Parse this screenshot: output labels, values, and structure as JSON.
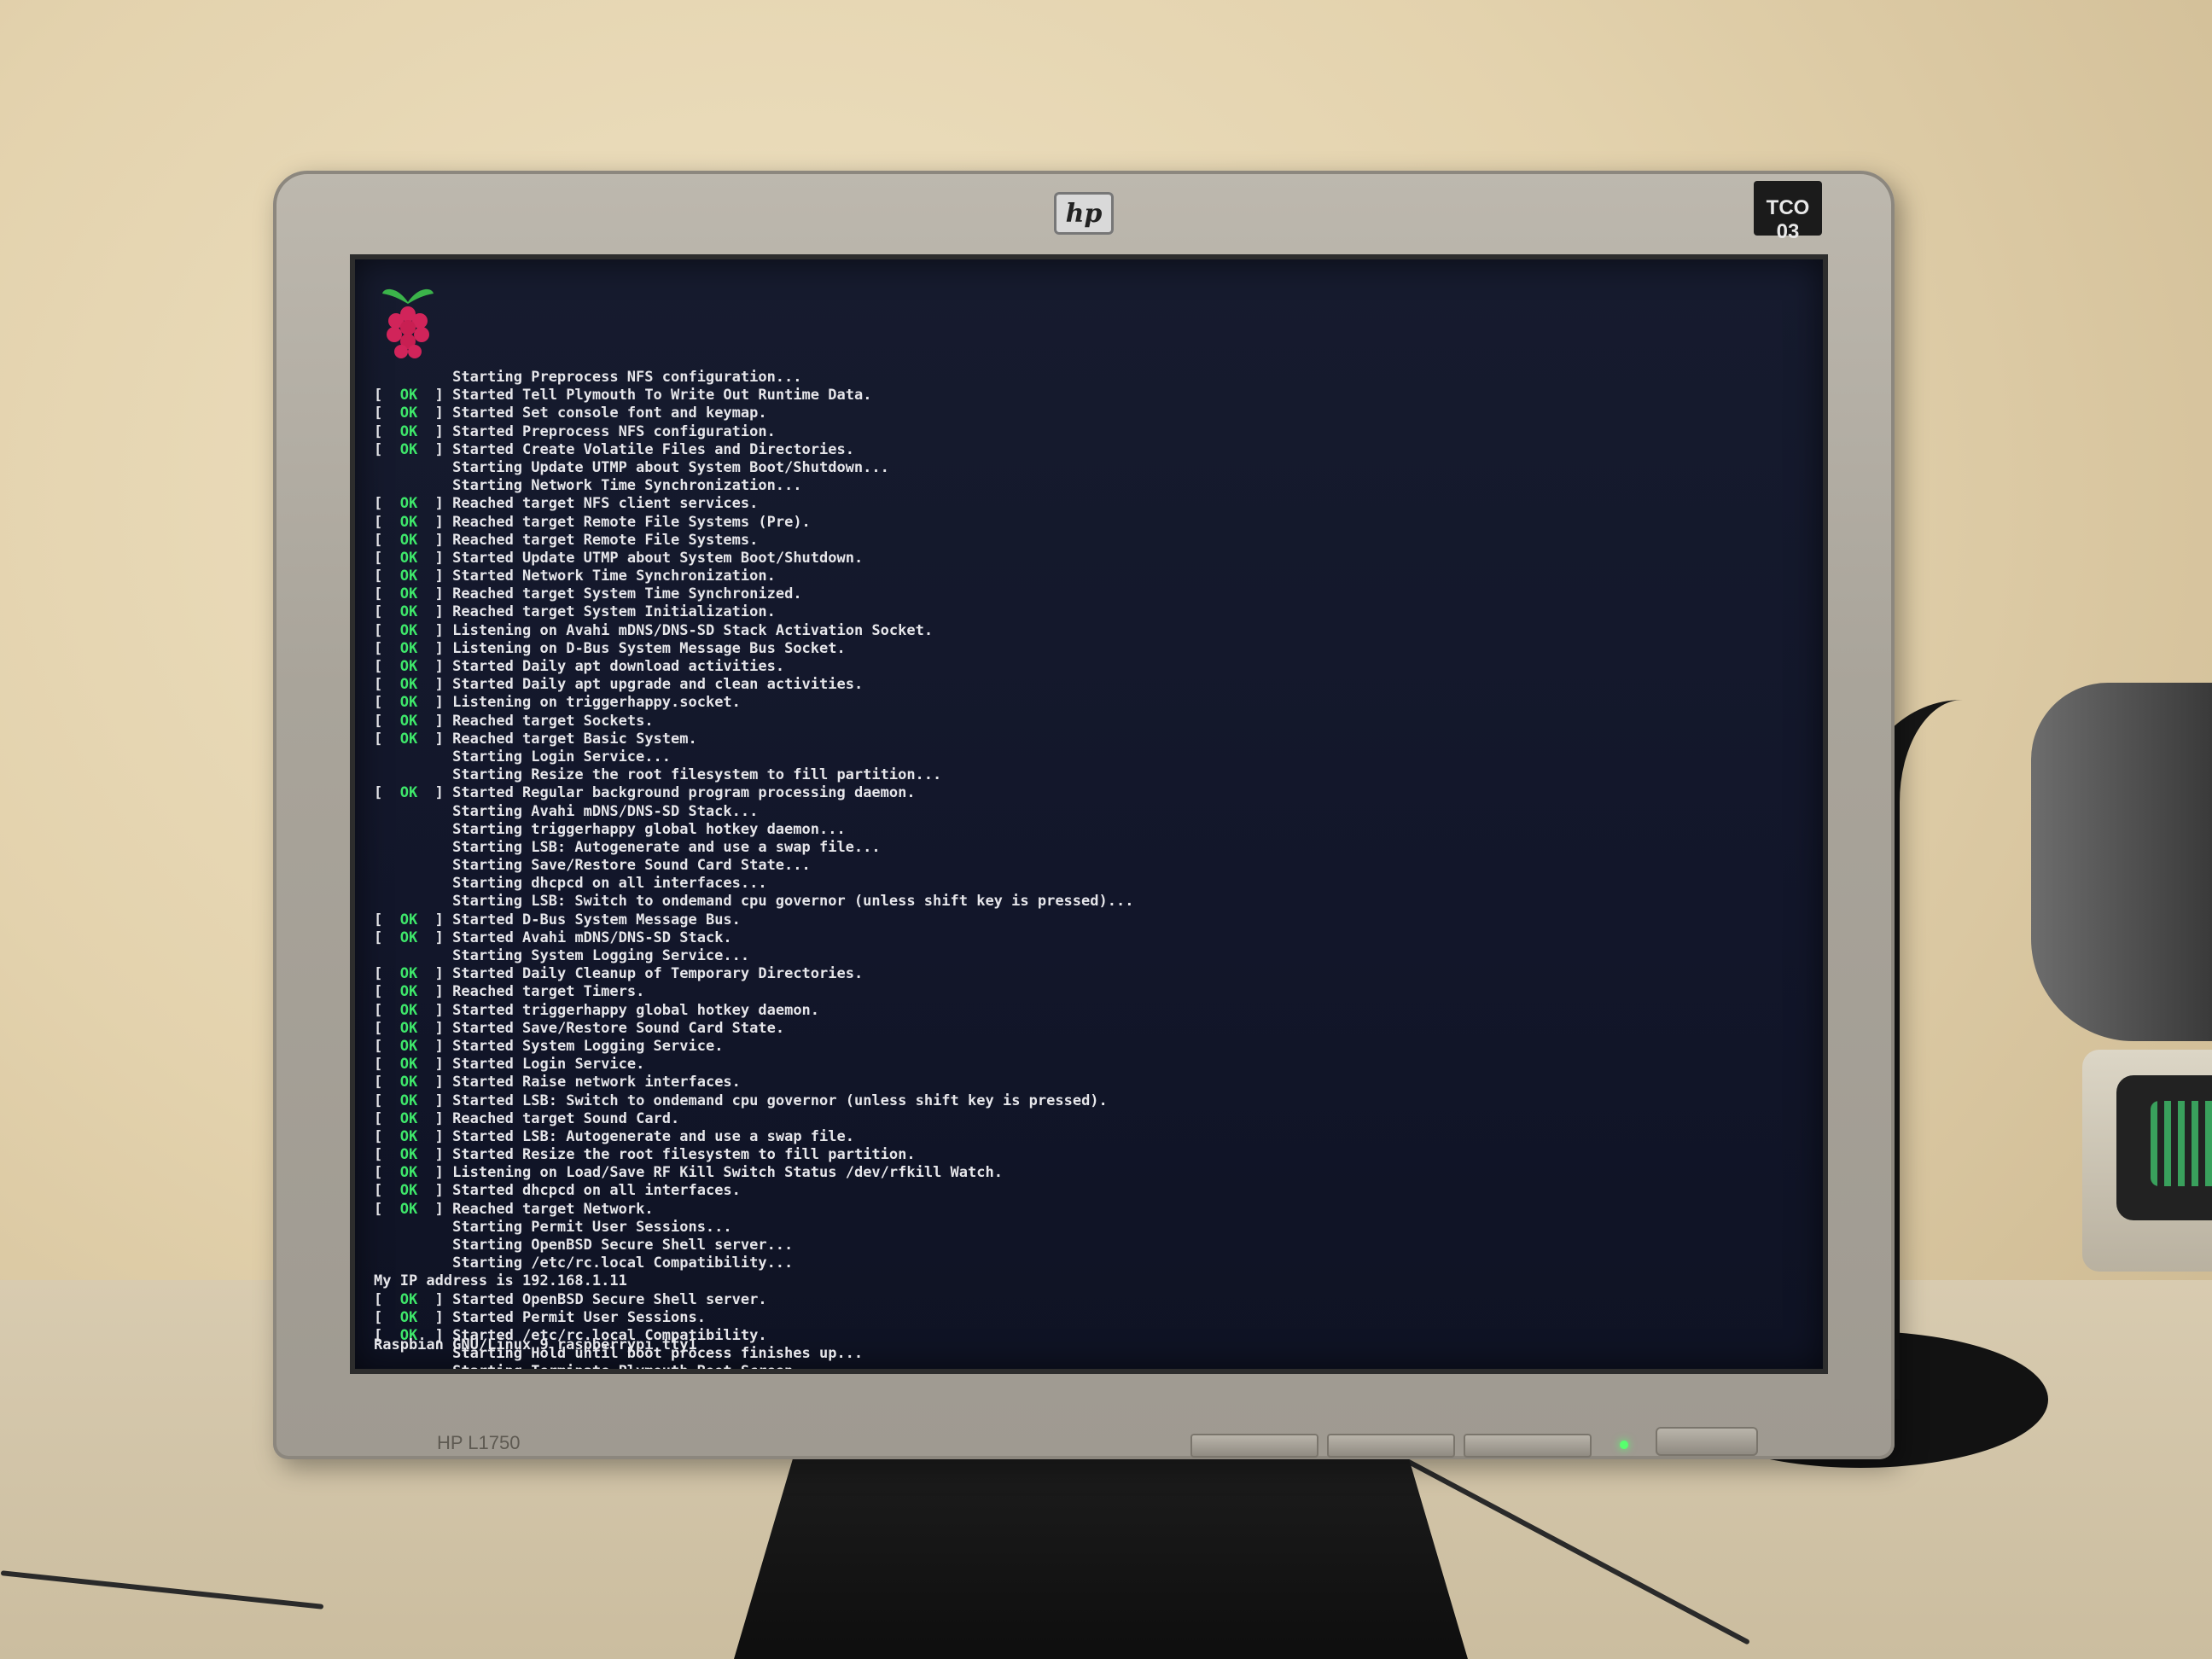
{
  "monitor": {
    "brand_logo": "hp",
    "badge": "TCO 03",
    "model": "HP L1750"
  },
  "screen": {
    "logo": "raspberry-pi-icon",
    "boot_log": [
      {
        "status": "",
        "text": "         Starting Preprocess NFS configuration..."
      },
      {
        "status": "OK",
        "text": "Started Tell Plymouth To Write Out Runtime Data."
      },
      {
        "status": "OK",
        "text": "Started Set console font and keymap."
      },
      {
        "status": "OK",
        "text": "Started Preprocess NFS configuration."
      },
      {
        "status": "OK",
        "text": "Started Create Volatile Files and Directories."
      },
      {
        "status": "",
        "text": "         Starting Update UTMP about System Boot/Shutdown..."
      },
      {
        "status": "",
        "text": "         Starting Network Time Synchronization..."
      },
      {
        "status": "OK",
        "text": "Reached target NFS client services."
      },
      {
        "status": "OK",
        "text": "Reached target Remote File Systems (Pre)."
      },
      {
        "status": "OK",
        "text": "Reached target Remote File Systems."
      },
      {
        "status": "OK",
        "text": "Started Update UTMP about System Boot/Shutdown."
      },
      {
        "status": "OK",
        "text": "Started Network Time Synchronization."
      },
      {
        "status": "OK",
        "text": "Reached target System Time Synchronized."
      },
      {
        "status": "OK",
        "text": "Reached target System Initialization."
      },
      {
        "status": "OK",
        "text": "Listening on Avahi mDNS/DNS-SD Stack Activation Socket."
      },
      {
        "status": "OK",
        "text": "Listening on D-Bus System Message Bus Socket."
      },
      {
        "status": "OK",
        "text": "Started Daily apt download activities."
      },
      {
        "status": "OK",
        "text": "Started Daily apt upgrade and clean activities."
      },
      {
        "status": "OK",
        "text": "Listening on triggerhappy.socket."
      },
      {
        "status": "OK",
        "text": "Reached target Sockets."
      },
      {
        "status": "OK",
        "text": "Reached target Basic System."
      },
      {
        "status": "",
        "text": "         Starting Login Service..."
      },
      {
        "status": "",
        "text": "         Starting Resize the root filesystem to fill partition..."
      },
      {
        "status": "OK",
        "text": "Started Regular background program processing daemon."
      },
      {
        "status": "",
        "text": "         Starting Avahi mDNS/DNS-SD Stack..."
      },
      {
        "status": "",
        "text": "         Starting triggerhappy global hotkey daemon..."
      },
      {
        "status": "",
        "text": "         Starting LSB: Autogenerate and use a swap file..."
      },
      {
        "status": "",
        "text": "         Starting Save/Restore Sound Card State..."
      },
      {
        "status": "",
        "text": "         Starting dhcpcd on all interfaces..."
      },
      {
        "status": "",
        "text": "         Starting LSB: Switch to ondemand cpu governor (unless shift key is pressed)..."
      },
      {
        "status": "OK",
        "text": "Started D-Bus System Message Bus."
      },
      {
        "status": "OK",
        "text": "Started Avahi mDNS/DNS-SD Stack."
      },
      {
        "status": "",
        "text": "         Starting System Logging Service..."
      },
      {
        "status": "OK",
        "text": "Started Daily Cleanup of Temporary Directories."
      },
      {
        "status": "OK",
        "text": "Reached target Timers."
      },
      {
        "status": "OK",
        "text": "Started triggerhappy global hotkey daemon."
      },
      {
        "status": "OK",
        "text": "Started Save/Restore Sound Card State."
      },
      {
        "status": "OK",
        "text": "Started System Logging Service."
      },
      {
        "status": "OK",
        "text": "Started Login Service."
      },
      {
        "status": "OK",
        "text": "Started Raise network interfaces."
      },
      {
        "status": "OK",
        "text": "Started LSB: Switch to ondemand cpu governor (unless shift key is pressed)."
      },
      {
        "status": "OK",
        "text": "Reached target Sound Card."
      },
      {
        "status": "OK",
        "text": "Started LSB: Autogenerate and use a swap file."
      },
      {
        "status": "OK",
        "text": "Started Resize the root filesystem to fill partition."
      },
      {
        "status": "OK",
        "text": "Listening on Load/Save RF Kill Switch Status /dev/rfkill Watch."
      },
      {
        "status": "OK",
        "text": "Started dhcpcd on all interfaces."
      },
      {
        "status": "OK",
        "text": "Reached target Network."
      },
      {
        "status": "",
        "text": "         Starting Permit User Sessions..."
      },
      {
        "status": "",
        "text": "         Starting OpenBSD Secure Shell server..."
      },
      {
        "status": "",
        "text": "         Starting /etc/rc.local Compatibility..."
      },
      {
        "status": "",
        "text": "My IP address is 192.168.1.11"
      },
      {
        "status": "OK",
        "text": "Started OpenBSD Secure Shell server."
      },
      {
        "status": "OK",
        "text": "Started Permit User Sessions."
      },
      {
        "status": "OK",
        "text": "Started /etc/rc.local Compatibility."
      },
      {
        "status": "",
        "text": "         Starting Hold until boot process finishes up..."
      },
      {
        "status": "",
        "text": "         Starting Terminate Plymouth Boot Screen..."
      }
    ],
    "login_prompt": "Raspbian GNU/Linux 9 raspberrypi tty1"
  },
  "colors": {
    "ok": "#3ee66a",
    "screen_bg": "#141a2c",
    "bezel": "#aaa59b"
  }
}
